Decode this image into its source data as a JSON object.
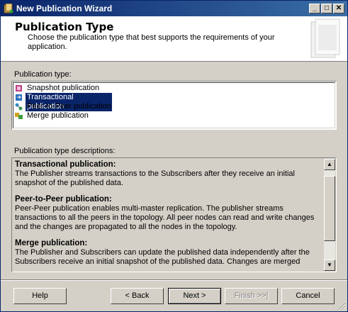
{
  "window": {
    "title": "New Publication Wizard",
    "minimize": "_",
    "maximize": "□",
    "close": "✕"
  },
  "header": {
    "title": "Publication Type",
    "description": "Choose the publication type that best supports the requirements of your application."
  },
  "publication_type": {
    "label": "Publication type:",
    "items": [
      {
        "label": "Snapshot publication",
        "icon": "snapshot-icon",
        "selected": false
      },
      {
        "label": "Transactional publication",
        "icon": "transactional-icon",
        "selected": true
      },
      {
        "label": "Peer-to-Peer publication",
        "icon": "peer-to-peer-icon",
        "selected": false
      },
      {
        "label": "Merge publication",
        "icon": "merge-icon",
        "selected": false
      }
    ]
  },
  "descriptions": {
    "label": "Publication type descriptions:",
    "sections": [
      {
        "heading": "Transactional publication:",
        "text": "The Publisher streams transactions to the Subscribers after they receive an initial snapshot of the published data."
      },
      {
        "heading": "Peer-to-Peer publication:",
        "text": "Peer-Peer publication enables multi-master replication. The publisher streams transactions to all the peers in the topology. All peer nodes can read and write changes and the changes are propagated to all the nodes in the topology."
      },
      {
        "heading": "Merge publication:",
        "text": "The Publisher and Subscribers can update the published data independently after the Subscribers receive an initial snapshot of the published data. Changes are merged"
      }
    ]
  },
  "buttons": {
    "help": "Help",
    "back": "< Back",
    "next": "Next >",
    "finish": "Finish >>|",
    "cancel": "Cancel"
  },
  "colors": {
    "selection": "#0a246a",
    "titlebar_start": "#0a246a",
    "titlebar_end": "#3a6ea5",
    "dialog_bg": "#d4d0c8"
  }
}
